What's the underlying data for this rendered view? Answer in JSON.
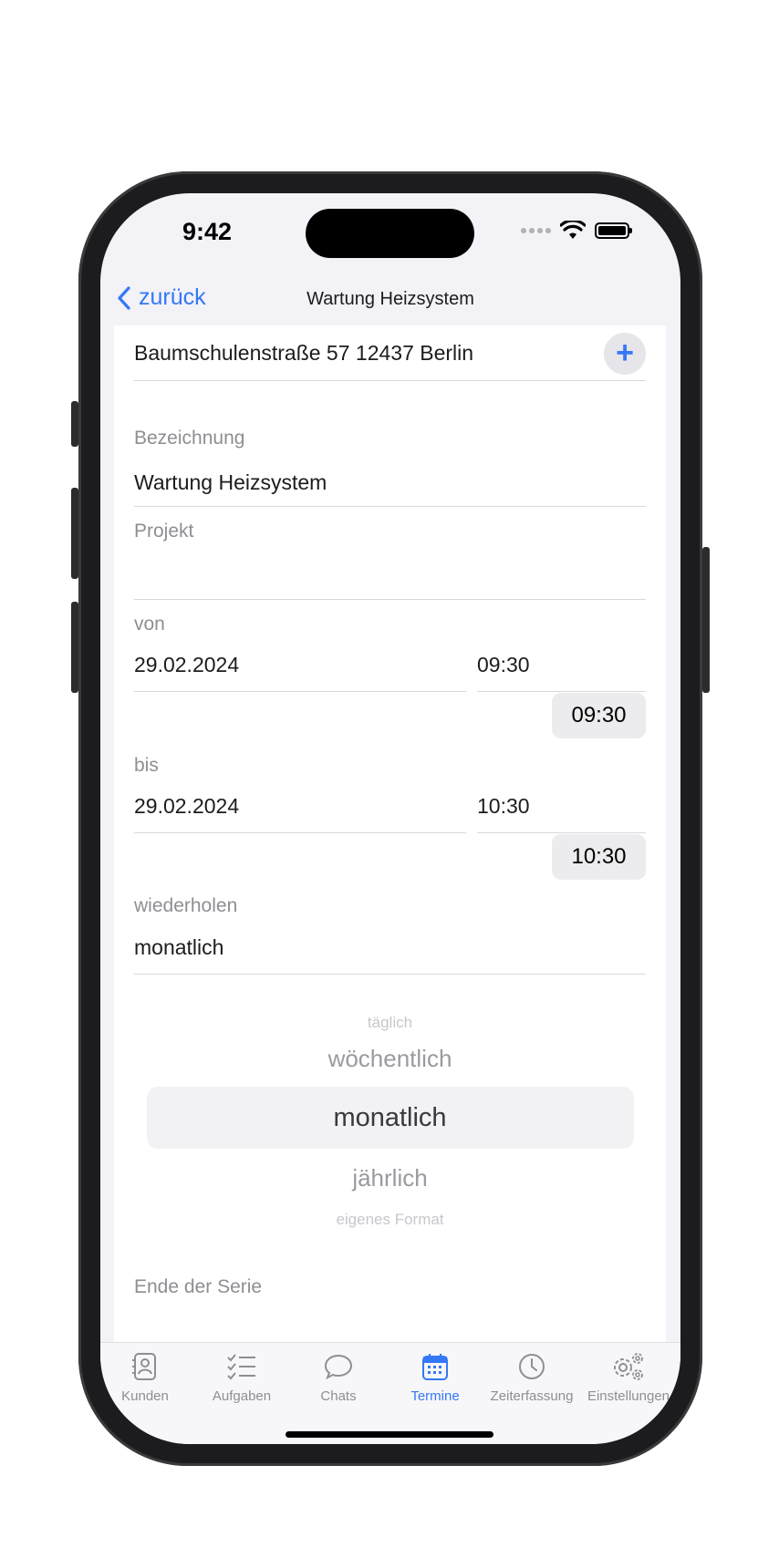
{
  "status": {
    "time": "9:42"
  },
  "nav": {
    "back_label": "zurück",
    "title": "Wartung Heizsystem"
  },
  "address": {
    "value": "Baumschulenstraße 57 12437 Berlin",
    "add_icon": "plus-icon"
  },
  "bezeichnung": {
    "label": "Bezeichnung",
    "value": "Wartung Heizsystem"
  },
  "projekt": {
    "label": "Projekt",
    "value": ""
  },
  "von": {
    "label": "von",
    "date": "29.02.2024",
    "time": "09:30",
    "time_chip": "09:30"
  },
  "bis": {
    "label": "bis",
    "date": "29.02.2024",
    "time": "10:30",
    "time_chip": "10:30"
  },
  "wiederholen": {
    "label": "wiederholen",
    "value": "monatlich",
    "options": [
      "täglich",
      "wöchentlich",
      "monatlich",
      "jährlich",
      "eigenes Format"
    ],
    "selected": "monatlich"
  },
  "ende": {
    "label": "Ende der Serie"
  },
  "tabs": [
    {
      "label": "Kunden",
      "icon": "contacts-icon"
    },
    {
      "label": "Aufgaben",
      "icon": "checklist-icon"
    },
    {
      "label": "Chats",
      "icon": "chat-bubble-icon"
    },
    {
      "label": "Termine",
      "icon": "calendar-icon",
      "active": true
    },
    {
      "label": "Zeiterfassung",
      "icon": "clock-icon"
    },
    {
      "label": "Einstellungen",
      "icon": "gears-icon"
    }
  ],
  "colors": {
    "accent": "#3478f6",
    "secondary_text": "#8e8e93",
    "background": "#f2f2f7"
  }
}
